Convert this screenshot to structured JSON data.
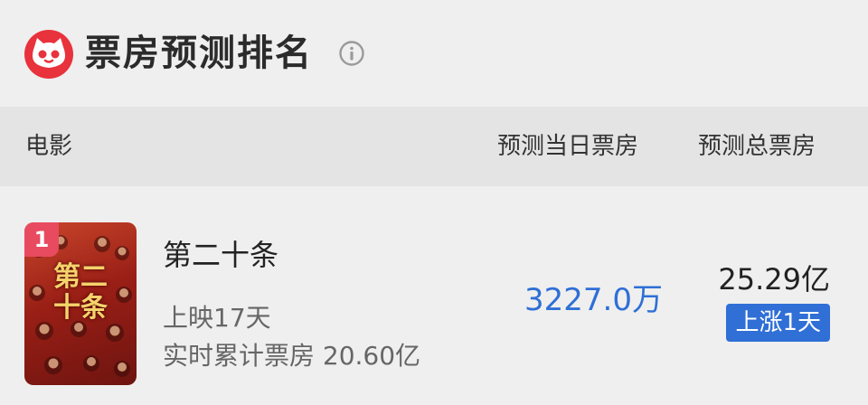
{
  "header": {
    "title": "票房预测排名",
    "logo_icon": "cat-logo-icon",
    "info_icon": "info-icon"
  },
  "table_header": {
    "movie": "电影",
    "daily_forecast": "预测当日票房",
    "total_forecast": "预测总票房"
  },
  "rows": [
    {
      "rank": "1",
      "poster_text": "第二十条",
      "name": "第二十条",
      "days_label": "上映17天",
      "cumulative_label": "实时累计票房 20.60亿",
      "daily_value": "3227.0万",
      "total_value": "25.29亿",
      "trend": "上涨1天"
    }
  ],
  "colors": {
    "brand_red": "#e8323c",
    "rank_badge": "#e84a5f",
    "accent_blue": "#2f6fd6"
  }
}
